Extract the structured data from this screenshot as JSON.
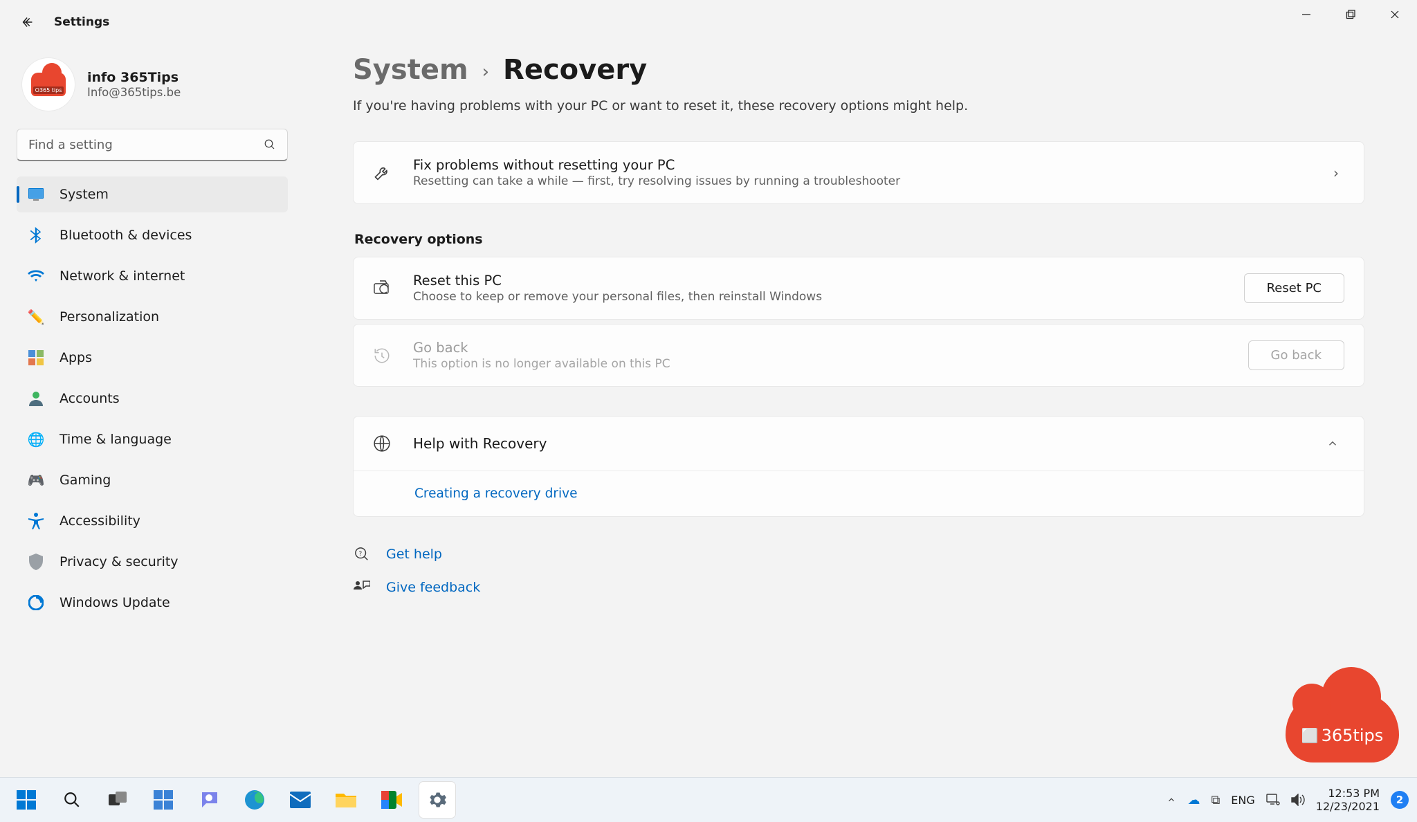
{
  "window": {
    "title": "Settings"
  },
  "account": {
    "name": "info 365Tips",
    "email": "Info@365tips.be"
  },
  "search": {
    "placeholder": "Find a setting"
  },
  "sidebar": {
    "items": [
      {
        "label": "System",
        "active": true
      },
      {
        "label": "Bluetooth & devices"
      },
      {
        "label": "Network & internet"
      },
      {
        "label": "Personalization"
      },
      {
        "label": "Apps"
      },
      {
        "label": "Accounts"
      },
      {
        "label": "Time & language"
      },
      {
        "label": "Gaming"
      },
      {
        "label": "Accessibility"
      },
      {
        "label": "Privacy & security"
      },
      {
        "label": "Windows Update"
      }
    ]
  },
  "breadcrumb": {
    "parent": "System",
    "page": "Recovery"
  },
  "intro": "If you're having problems with your PC or want to reset it, these recovery options might help.",
  "fix_card": {
    "title": "Fix problems without resetting your PC",
    "sub": "Resetting can take a while — first, try resolving issues by running a troubleshooter"
  },
  "section_label": "Recovery options",
  "reset_card": {
    "title": "Reset this PC",
    "sub": "Choose to keep or remove your personal files, then reinstall Windows",
    "button": "Reset PC"
  },
  "goback_card": {
    "title": "Go back",
    "sub": "This option is no longer available on this PC",
    "button": "Go back"
  },
  "help_expander": {
    "title": "Help with Recovery",
    "link1": "Creating a recovery drive"
  },
  "footer": {
    "get_help": "Get help",
    "give_feedback": "Give feedback"
  },
  "watermark": {
    "text": "365tips"
  },
  "taskbar": {
    "lang": "ENG",
    "time": "12:53 PM",
    "date": "12/23/2021",
    "badge": "2"
  }
}
